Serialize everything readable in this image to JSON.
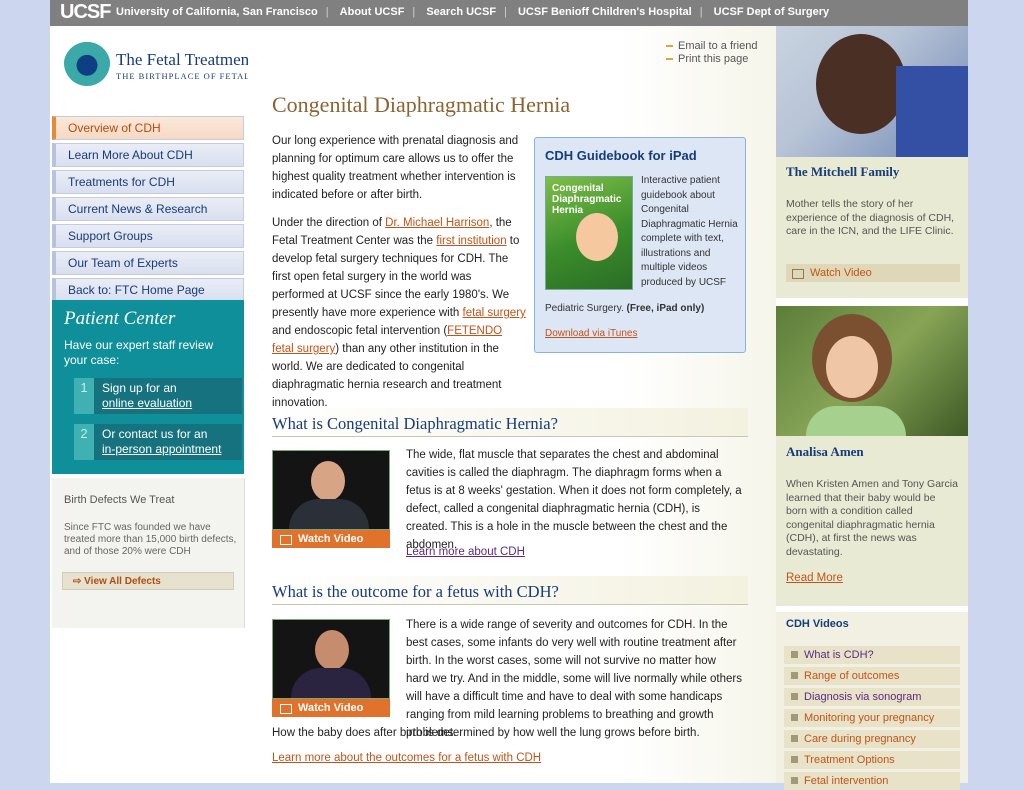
{
  "topbar": {
    "logo": "UCSF",
    "links": [
      "University of California, San Francisco",
      "About UCSF",
      "Search UCSF",
      "UCSF Benioff Children's Hospital",
      "UCSF Dept of Surgery"
    ]
  },
  "brand": {
    "title": "The Fetal Treatment Center",
    "tagline": "THE BIRTHPLACE OF FETAL SURGERY"
  },
  "tools": {
    "email": "Email to a friend",
    "print": "Print this page"
  },
  "leftnav": {
    "items": [
      {
        "label": "Overview of CDH",
        "active": true
      },
      {
        "label": "Learn More About CDH",
        "active": false
      },
      {
        "label": "Treatments for CDH",
        "active": false
      },
      {
        "label": "Current News & Research",
        "active": false
      },
      {
        "label": "Support Groups",
        "active": false
      },
      {
        "label": "Our Team of Experts",
        "active": false
      },
      {
        "label": "Back to: FTC Home Page",
        "active": false
      }
    ]
  },
  "patient_center": {
    "heading": "Patient Center",
    "desc": "Have our expert staff review your case:",
    "step1": {
      "num": "1",
      "line1": "Sign up for an",
      "line2": "online evaluation"
    },
    "step2": {
      "num": "2",
      "line1": "Or contact us for an",
      "line2": "in-person appointment"
    }
  },
  "defects": {
    "heading": "Birth Defects We Treat",
    "desc": "Since FTC was founded we have treated more than 15,000 birth defects, and of those 20% were CDH",
    "button": "View All Defects"
  },
  "main": {
    "title": "Congenital Diaphragmatic Hernia",
    "intro1": "Our long experience with prenatal diagnosis and planning for optimum care allows us to offer the highest quality treatment whether intervention is indicated before or after birth.",
    "intro2_a": "Under the direction of ",
    "intro2_link1": "Dr. Michael Harrison",
    "intro2_b": ", the Fetal Treatment Center was the ",
    "intro2_link2": "first institution",
    "intro2_c": " to develop fetal surgery techniques for CDH. The first open fetal surgery in the world was performed at UCSF since the early 1980's. We presently have more experience with ",
    "intro2_link3": "fetal surgery",
    "intro2_d": " and endoscopic fetal intervention (",
    "intro2_link4": "FETENDO fetal surgery",
    "intro2_e": ") than any other institution in the world. We are dedicated to congenital diaphragmatic hernia research and treatment innovation."
  },
  "guidebook": {
    "heading": "CDH Guidebook for iPad",
    "cover_title": "Congenital Diaphragmatic Hernia",
    "desc": "Interactive patient guidebook about Congenital Diaphragmatic Hernia complete with text, illustrations and multiple videos produced by UCSF",
    "desc2": "Pediatric Surgery.",
    "desc2_bold": " (Free, iPad only)",
    "link": "Download via iTunes"
  },
  "section1": {
    "heading": "What is Congenital Diaphragmatic Hernia?",
    "text": "The wide, flat muscle that separates the chest and abdominal cavities is called the diaphragm. The diaphragm forms when a fetus is at 8 weeks' gestation. When it does not form completely, a defect, called a congenital diaphragmatic hernia (CDH), is created. This is a hole in the muscle between the chest and the abdomen.",
    "link": "Learn more about CDH",
    "video": "Watch Video"
  },
  "section2": {
    "heading": "What is the outcome for a fetus with CDH?",
    "text": "There is a wide range of severity and outcomes for CDH. In the best cases, some infants do very well with routine treatment after birth. In the worst cases, some will not survive no matter how hard we try. And in the middle, some will live normally while others will have a difficult time and have to deal with some handicaps ranging from mild learning problems to breathing and growth problems.",
    "tail": "How the baby does after birth is determined by how well the lung grows before birth.",
    "link": "Learn more about the outcomes for a fetus with CDH",
    "video": "Watch Video"
  },
  "right": {
    "card1": {
      "name": "The Mitchell Family",
      "desc": "Mother tells the story of her experience of the diagnosis of CDH, care in the ICN, and the LIFE Clinic.",
      "button": "Watch Video"
    },
    "card2": {
      "name": "Analisa Amen",
      "desc": "When Kristen Amen and Tony Garcia learned that their baby would be born with a condition called congenital diaphragmatic hernia (CDH), at first the news was devastating.",
      "link": "Read More"
    },
    "videos": {
      "heading": "CDH Videos",
      "items": [
        {
          "label": "What is CDH?",
          "visited": true
        },
        {
          "label": "Range of outcomes",
          "visited": false
        },
        {
          "label": "Diagnosis via sonogram",
          "visited": true
        },
        {
          "label": "Monitoring your pregnancy",
          "visited": false
        },
        {
          "label": "Care during pregnancy",
          "visited": false
        },
        {
          "label": "Treatment Options",
          "visited": false
        },
        {
          "label": "Fetal intervention",
          "visited": false
        }
      ]
    }
  },
  "colors": {
    "topbar": "#808080",
    "accent_orange": "#e0722b",
    "brand_blue": "#163c7a",
    "teal": "#0e8f9a",
    "page_bg": "#cdd6ef"
  }
}
